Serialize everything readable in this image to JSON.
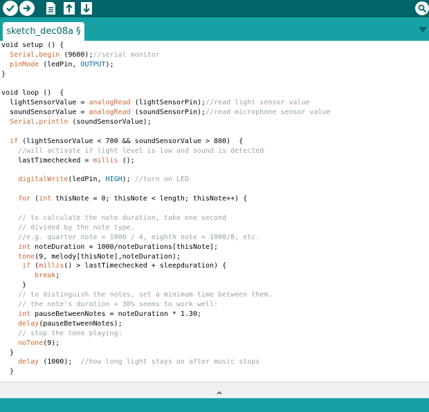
{
  "toolbar": {
    "buttons": [
      {
        "name": "verify",
        "icon": "check-icon"
      },
      {
        "name": "upload",
        "icon": "arrow-right-icon"
      },
      {
        "name": "new",
        "icon": "new-file-icon"
      },
      {
        "name": "open",
        "icon": "arrow-up-icon"
      },
      {
        "name": "save",
        "icon": "arrow-down-icon"
      }
    ],
    "serial_monitor_icon": "magnifier-icon"
  },
  "tab": {
    "label": "sketch_dec08a §",
    "menu_icon": "triangle-down-icon"
  },
  "colors": {
    "toolbar": "#006468",
    "tabbar": "#17a1a5",
    "keyword": "#cc6633",
    "constant": "#006699",
    "comment": "#95a5a6"
  },
  "code_lines": [
    [
      [
        "t",
        "void setup () {"
      ]
    ],
    [
      [
        "t",
        "  "
      ],
      [
        "fn",
        "Serial"
      ],
      [
        "t",
        "."
      ],
      [
        "fn",
        "begin"
      ],
      [
        "t",
        " (9600);"
      ],
      [
        "cm",
        "//serial monitor"
      ]
    ],
    [
      [
        "t",
        "  "
      ],
      [
        "fn",
        "pinMode"
      ],
      [
        "t",
        " (ledPin, "
      ],
      [
        "cn",
        "OUTPUT"
      ],
      [
        "t",
        ");"
      ]
    ],
    [
      [
        "t",
        "}"
      ]
    ],
    [
      [
        "t",
        ""
      ]
    ],
    [
      [
        "t",
        "void loop ()  {"
      ]
    ],
    [
      [
        "t",
        "  lightSensorValue = "
      ],
      [
        "fn",
        "analogRead"
      ],
      [
        "t",
        " (lightSensorPin);"
      ],
      [
        "cm",
        "//read light sensor value"
      ]
    ],
    [
      [
        "t",
        "  soundSensorValue = "
      ],
      [
        "fn",
        "analogRead"
      ],
      [
        "t",
        " (soundSensorPin);"
      ],
      [
        "cm",
        "//read microphone sensor value"
      ]
    ],
    [
      [
        "t",
        "  "
      ],
      [
        "fn",
        "Serial"
      ],
      [
        "t",
        "."
      ],
      [
        "fn",
        "println"
      ],
      [
        "t",
        " (soundSensorValue);"
      ]
    ],
    [
      [
        "t",
        ""
      ]
    ],
    [
      [
        "t",
        "  "
      ],
      [
        "kw",
        "if"
      ],
      [
        "t",
        " (lightSensorValue < 700 && soundSensorValue > 800)  {"
      ]
    ],
    [
      [
        "t",
        "    "
      ],
      [
        "cm",
        "//will activate if light level is low and sound is detected"
      ]
    ],
    [
      [
        "t",
        "    lastTimechecked = "
      ],
      [
        "fn",
        "millis"
      ],
      [
        "t",
        " ();"
      ]
    ],
    [
      [
        "t",
        ""
      ]
    ],
    [
      [
        "t",
        "    "
      ],
      [
        "fn",
        "digitalWrite"
      ],
      [
        "t",
        "(ledPin, "
      ],
      [
        "cn",
        "HIGH"
      ],
      [
        "t",
        "); "
      ],
      [
        "cm",
        "//turn on LED"
      ]
    ],
    [
      [
        "t",
        ""
      ]
    ],
    [
      [
        "t",
        "    "
      ],
      [
        "kw",
        "for"
      ],
      [
        "t",
        " ("
      ],
      [
        "ty",
        "int"
      ],
      [
        "t",
        " thisNote = 0; thisNote < length; thisNote++) {"
      ]
    ],
    [
      [
        "t",
        ""
      ]
    ],
    [
      [
        "t",
        "    "
      ],
      [
        "cm",
        "// to calculate the note duration, take one second"
      ]
    ],
    [
      [
        "t",
        "    "
      ],
      [
        "cm",
        "// divided by the note type."
      ]
    ],
    [
      [
        "t",
        "    "
      ],
      [
        "cm",
        "//e.g. quarter note = 1000 / 4, eighth note = 1000/8, etc."
      ]
    ],
    [
      [
        "t",
        "    "
      ],
      [
        "ty",
        "int"
      ],
      [
        "t",
        " noteDuration = 1000/noteDurations[thisNote];"
      ]
    ],
    [
      [
        "t",
        "    "
      ],
      [
        "fn",
        "tone"
      ],
      [
        "t",
        "(9, melody[thisNote],noteDuration);"
      ]
    ],
    [
      [
        "t",
        "     "
      ],
      [
        "kw",
        "if"
      ],
      [
        "t",
        " ("
      ],
      [
        "fn",
        "millis"
      ],
      [
        "t",
        "() > lastTimechecked + sleepduration) {"
      ]
    ],
    [
      [
        "t",
        "        "
      ],
      [
        "kw",
        "break"
      ],
      [
        "t",
        ";"
      ]
    ],
    [
      [
        "t",
        "     }"
      ]
    ],
    [
      [
        "t",
        "    "
      ],
      [
        "cm",
        "// to distinguish the notes, set a minimum time between them."
      ]
    ],
    [
      [
        "t",
        "    "
      ],
      [
        "cm",
        "// the note's duration + 30% seems to work well:"
      ]
    ],
    [
      [
        "t",
        "    "
      ],
      [
        "ty",
        "int"
      ],
      [
        "t",
        " pauseBetweenNotes = noteDuration * 1.30;"
      ]
    ],
    [
      [
        "t",
        "    "
      ],
      [
        "fn",
        "delay"
      ],
      [
        "t",
        "(pauseBetweenNotes);"
      ]
    ],
    [
      [
        "t",
        "    "
      ],
      [
        "cm",
        "// stop the tone playing:"
      ]
    ],
    [
      [
        "t",
        "    "
      ],
      [
        "fn",
        "noTone"
      ],
      [
        "t",
        "(9);"
      ]
    ],
    [
      [
        "t",
        "  }"
      ]
    ],
    [
      [
        "t",
        "    "
      ],
      [
        "fn",
        "delay"
      ],
      [
        "t",
        " (1000);  "
      ],
      [
        "cm",
        "//how long light stays on after music stops"
      ]
    ],
    [
      [
        "t",
        "  }"
      ]
    ]
  ],
  "splitter": {
    "icon": "chevron-up-icon"
  }
}
